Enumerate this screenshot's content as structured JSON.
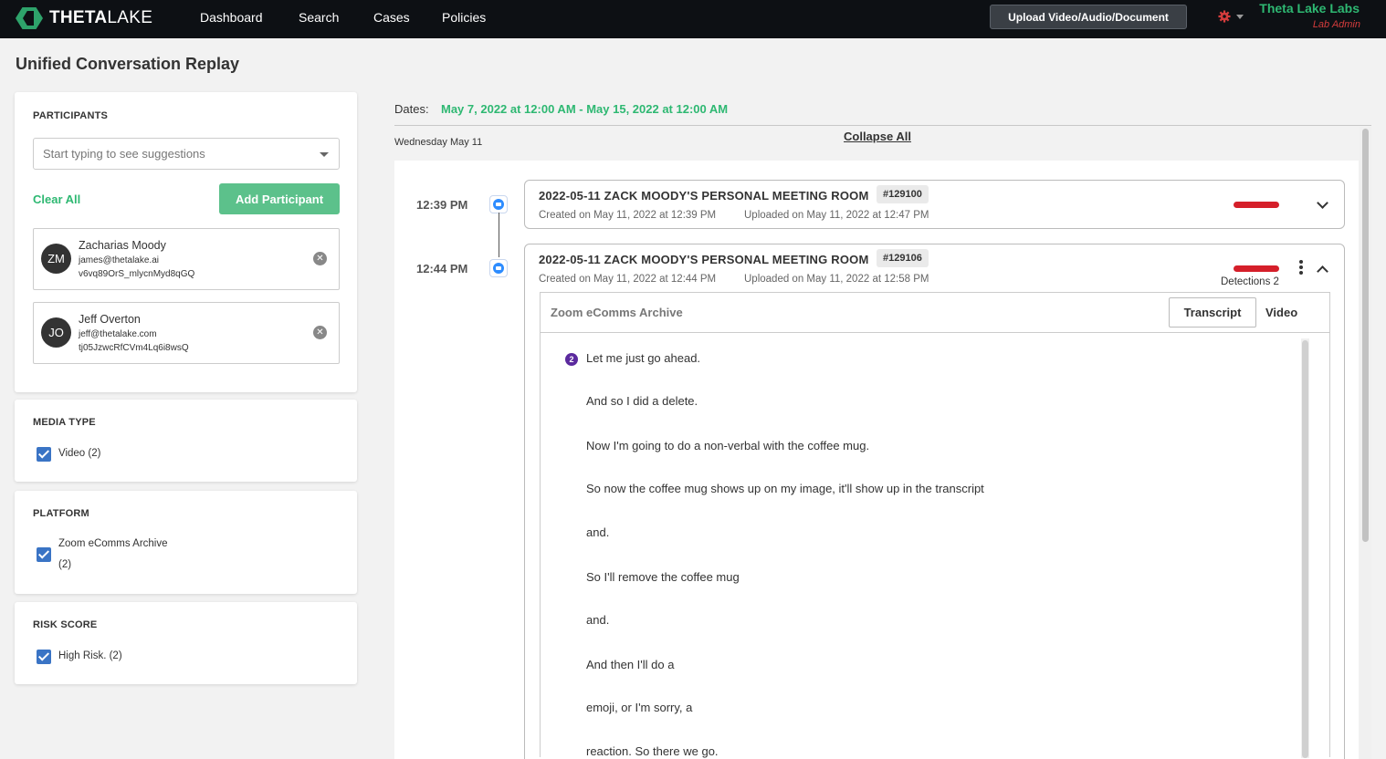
{
  "nav": {
    "logo_bold": "THETA",
    "logo_light": "LAKE",
    "items": [
      "Dashboard",
      "Search",
      "Cases",
      "Policies"
    ],
    "upload_label": "Upload Video/Audio/Document",
    "org_name": "Theta Lake Labs",
    "org_role": "Lab Admin"
  },
  "page_title": "Unified Conversation Replay",
  "participants": {
    "title": "PARTICIPANTS",
    "search_placeholder": "Start typing to see suggestions",
    "clear_all": "Clear All",
    "add_button": "Add Participant",
    "list": [
      {
        "initials": "ZM",
        "name": "Zacharias Moody",
        "email": "james@thetalake.ai",
        "id": "v6vq89OrS_mlycnMyd8qGQ"
      },
      {
        "initials": "JO",
        "name": "Jeff Overton",
        "email": "jeff@thetalake.com",
        "id": "tj05JzwcRfCVm4Lq6i8wsQ"
      }
    ]
  },
  "media_type": {
    "title": "MEDIA TYPE",
    "option": "Video (2)"
  },
  "platform": {
    "title": "PLATFORM",
    "option_line1": "Zoom eComms Archive",
    "option_line2": "(2)"
  },
  "risk_score": {
    "title": "RISK SCORE",
    "option": "High Risk. (2)"
  },
  "timeline": {
    "dates_label": "Dates:",
    "dates_value": "May 7, 2022 at 12:00 AM - May 15, 2022 at 12:00 AM",
    "day_label": "Wednesday May 11",
    "collapse_all": "Collapse All",
    "records": [
      {
        "time": "12:39 PM",
        "title": "2022-05-11 ZACK MOODY'S PERSONAL MEETING ROOM",
        "badge": "#129100",
        "created": "Created on May 11, 2022 at 12:39 PM",
        "uploaded": "Uploaded on May 11, 2022 at 12:47 PM"
      },
      {
        "time": "12:44 PM",
        "title": "2022-05-11 ZACK MOODY'S PERSONAL MEETING ROOM",
        "badge": "#129106",
        "created": "Created on May 11, 2022 at 12:44 PM",
        "uploaded": "Uploaded on May 11, 2022 at 12:58 PM",
        "detections": "Detections 2",
        "panel_title": "Zoom eComms Archive",
        "tab_transcript": "Transcript",
        "tab_video": "Video",
        "speaker_number": "2",
        "transcript": [
          "Let me just go ahead.",
          "And so I did a delete.",
          "Now I'm going to do a non-verbal with the coffee mug.",
          "So now the coffee mug shows up on my image, it'll show up in the transcript",
          "and.",
          "So I'll remove the coffee mug",
          "and.",
          "And then I'll do a",
          "emoji, or I'm sorry, a",
          "reaction. So there we go."
        ]
      }
    ]
  },
  "colors": {
    "accent_green": "#2eb872",
    "risk_red": "#d51f2a",
    "nav_bg": "#0d1014"
  }
}
